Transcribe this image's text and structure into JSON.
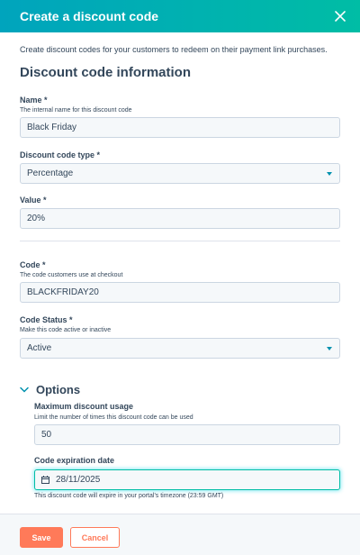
{
  "modal": {
    "title": "Create a discount code",
    "close_icon": "close-icon"
  },
  "intro": "Create discount codes for your customers to redeem on their payment link purchases.",
  "section_title": "Discount code information",
  "fields": {
    "name": {
      "label": "Name *",
      "help": "The internal name for this discount code",
      "value": "Black Friday"
    },
    "type": {
      "label": "Discount code type *",
      "value": "Percentage"
    },
    "value": {
      "label": "Value *",
      "value": "20%"
    },
    "code": {
      "label": "Code *",
      "help": "The code customers use at checkout",
      "value": "BLACKFRIDAY20"
    },
    "status": {
      "label": "Code Status *",
      "help": "Make this code active or inactive",
      "value": "Active"
    }
  },
  "options": {
    "title": "Options",
    "max_usage": {
      "label": "Maximum discount usage",
      "help": "Limit the number of times this discount code can be used",
      "value": "50"
    },
    "expiration": {
      "label": "Code expiration date",
      "value": "28/11/2025",
      "help": "This discount code will expire in your portal's timezone (23:59 GMT)"
    }
  },
  "footer": {
    "save_label": "Save",
    "cancel_label": "Cancel"
  },
  "colors": {
    "header_start": "#00a4bd",
    "header_end": "#00bda5",
    "primary_button": "#ff7a59",
    "text": "#33475b",
    "link": "#0091ae"
  }
}
